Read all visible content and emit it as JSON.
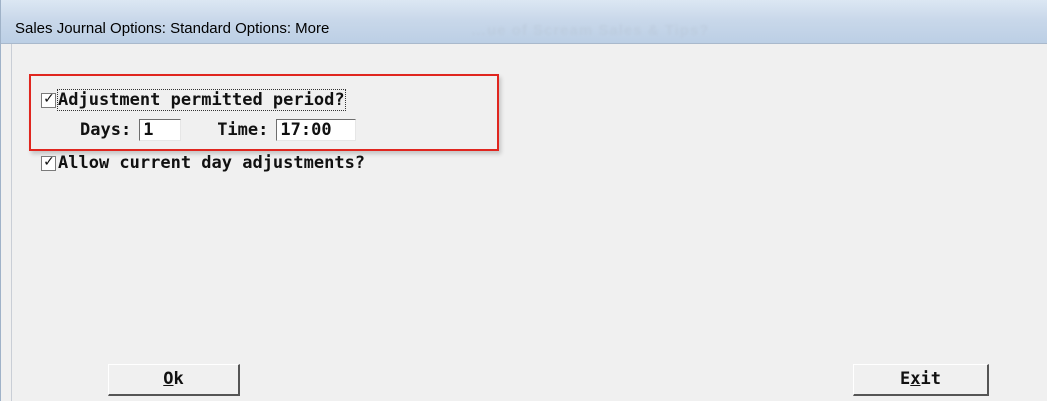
{
  "window": {
    "title": "Sales Journal Options:  Standard Options: More",
    "background_title_ghost": "…ue of Scream Sales & Tips?"
  },
  "options": {
    "adjustment_period": {
      "checked": true,
      "check_glyph": "✓",
      "label": "Adjustment permitted period?",
      "days_label": "Days:",
      "days_value": "1",
      "time_label": "Time:",
      "time_value": "17:00"
    },
    "current_day": {
      "checked": true,
      "check_glyph": "✓",
      "label": "Allow current day adjustments?"
    }
  },
  "buttons": {
    "ok_hotkey": "O",
    "ok_rest": "k",
    "exit_pre": "E",
    "exit_hotkey": "x",
    "exit_rest": "it"
  },
  "colors": {
    "highlight_border": "#e0261f",
    "window_bg": "#f0f0f0"
  }
}
